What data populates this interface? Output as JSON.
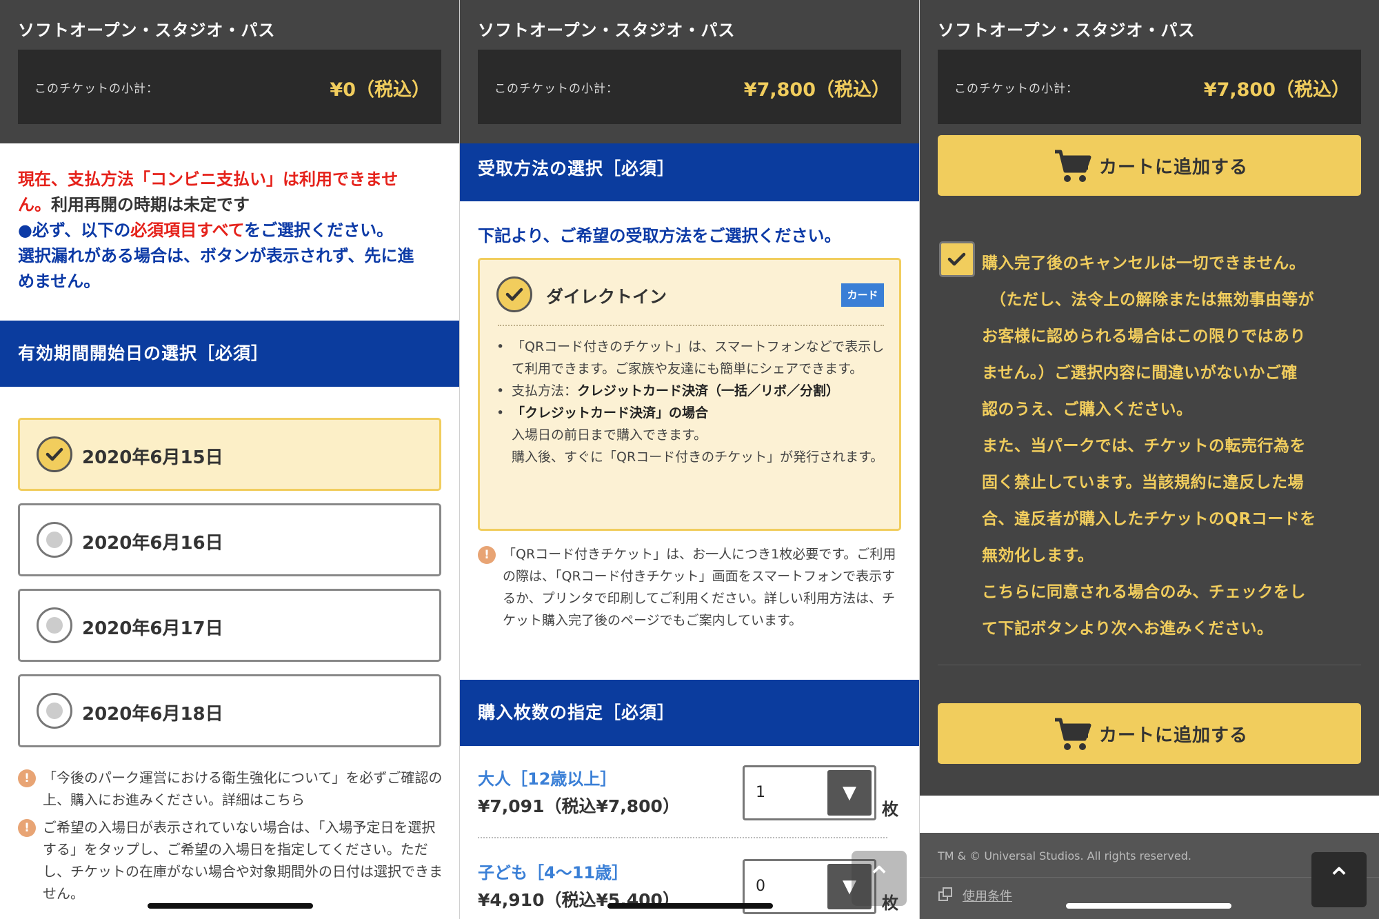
{
  "product_title": "ソフトオープン・スタジオ・パス",
  "subtotal_label": "このチケットの小計：",
  "panel1": {
    "subtotal_value": "¥0（税込）",
    "notice": {
      "line1_red": "現在、支払方法「コンビニ支払い」は利用できませ",
      "line2_red": "ん。",
      "line2_dark": "利用再開の時期は未定です",
      "line3_navy_a": "●必ず、以下の",
      "line3_red": "必須項目すべて",
      "line3_navy_b": "をご選択ください。",
      "line4_navy": "選択漏れがある場合は、ボタンが表示されず、先に進",
      "line5_navy": "めません。"
    },
    "date_section_title": "有効期間開始日の選択［必須］",
    "dates": [
      {
        "label": "2020年6月15日",
        "selected": true
      },
      {
        "label": "2020年6月16日",
        "selected": false
      },
      {
        "label": "2020年6月17日",
        "selected": false
      },
      {
        "label": "2020年6月18日",
        "selected": false
      }
    ],
    "warnings": [
      "「今後のパーク運営における衛生強化について」を必ずご確認の上、購入にお進みください。詳細はこちら",
      "ご希望の入場日が表示されていない場合は、「入場予定日を選択する」をタップし、ご希望の入場日を指定してください。ただし、チケットの在庫がない場合や対象期間外の日付は選択できません。"
    ]
  },
  "panel2": {
    "subtotal_value": "¥7,800（税込）",
    "receive_section_title": "受取方法の選択［必須］",
    "lead": "下記より、ご希望の受取方法をご選択ください。",
    "method_name": "ダイレクトイン",
    "method_badge": "カード",
    "bullets": {
      "b1": "「QRコード付きのチケット」は、スマートフォンなどで表示して利用できます。ご家族や友達にも簡単にシェアできます。",
      "b2_label": "支払方法：",
      "b2_value": "クレジットカード決済（一括／リボ／分割）",
      "b3_title": "「クレジットカード決済」の場合",
      "b3_line1": "入場日の前日まで購入できます。",
      "b3_line2": "購入後、すぐに「QRコード付きのチケット」が発行されます。"
    },
    "warning": "「QRコード付きチケット」は、お一人につき1枚必要です。ご利用の際は、「QRコード付きチケット」画面をスマートフォンで表示するか、プリンタで印刷してご利用ください。詳しい利用方法は、チケット購入完了後のページでもご案内しています。",
    "qty_section_title": "購入枚数の指定［必須］",
    "quantities": [
      {
        "name": "大人［12歳以上］",
        "price": "¥7,091（税込¥7,800）",
        "value": "1",
        "unit": "枚"
      },
      {
        "name": "子ども［4〜11歳］",
        "price": "¥4,910（税込¥5,400）",
        "value": "0",
        "unit": "枚"
      }
    ]
  },
  "panel3": {
    "subtotal_value": "¥7,800（税込）",
    "cart_button_label": "カートに追加する",
    "consent_lines": [
      "購入完了後のキャンセルは一切できません。",
      "（ただし、法令上の解除または無効事由等が",
      "お客様に認められる場合はこの限りではあり",
      "ません。）ご選択内容に間違いがないかご確",
      "認のうえ、ご購入ください。",
      "また、当パークでは、チケットの転売行為を",
      "固く禁止しています。当該規約に違反した場",
      "合、違反者が購入したチケットのQRコードを",
      "無効化します。",
      "こちらに同意される場合のみ、チェックをし",
      "て下記ボタンより次へお進みください。"
    ],
    "copyright": "TM & © Universal Studios. All rights reserved.",
    "terms_link": "使用条件"
  },
  "icons": {
    "check": "check-icon",
    "warning": "exclamation-icon",
    "cart": "cart-icon",
    "dropdown": "triangle-down-icon",
    "scroll_top": "chevron-up-icon",
    "external": "external-link-icon"
  },
  "colors": {
    "brand_blue": "#0b3c9e",
    "gold": "#f1cd5d",
    "header_gray": "#444444",
    "alert_red": "#e5221b"
  }
}
